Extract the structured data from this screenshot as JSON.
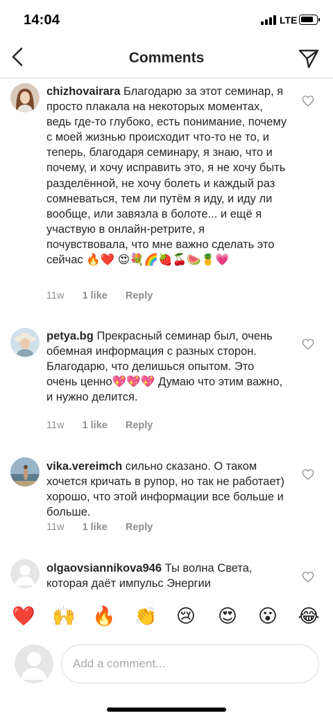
{
  "status_bar": {
    "time": "14:04",
    "network": "LTE"
  },
  "header": {
    "title": "Comments",
    "back_icon": "chevron-left-icon",
    "share_icon": "paper-plane-icon"
  },
  "comments": [
    {
      "username": "chizhovairara",
      "text": "Благодарю за этот семинар, я просто плакала на некоторых моментах, ведь где-то глубоко, есть понимание, почему с моей жизнью происходит что-то не то, и теперь, благодаря семинару, я знаю, что и почему, и хочу исправить это, я не хочу быть разделённой, не хочу болеть и каждый раз сомневаться, тем ли путём я иду, и иду ли вообще, или завязла в болоте... и ещё я участвую в онлайн-ретрите, я почувствовала, что мне важно сделать это сейчас 🔥❤️ 😍💐🌈🍓🍒🍉🍍💗",
      "time": "11w",
      "likes": "1 like",
      "reply": "Reply"
    },
    {
      "username": "petya.bg",
      "text": "Прекрасный семинар был, очень обемная информация с разных сторон. Благодарю, что делишься опытом. Это очень ценно💖💖💖 Думаю что этим важно, и нужно делится.",
      "time": "11w",
      "likes": "1 like",
      "reply": "Reply"
    },
    {
      "username": "vika.vereimch",
      "text": "сильно сказано. О таком хочется кричать в рупор, но так не работает) хорошо, что этой информации все больше и больше.",
      "time": "11w",
      "likes": "1 like",
      "reply": "Reply"
    },
    {
      "username": "olgaovsiannikova946",
      "text": "Ты волна Света, которая  даёт импульс Энергии"
    }
  ],
  "emoji_bar": [
    "❤️",
    "🙌",
    "🔥",
    "👏",
    "😢",
    "😍",
    "😮",
    "😂"
  ],
  "input": {
    "placeholder": "Add a comment..."
  }
}
